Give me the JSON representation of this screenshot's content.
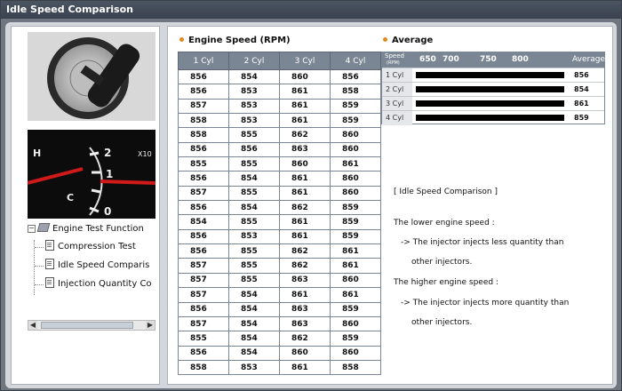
{
  "window": {
    "title": "Idle Speed Comparison"
  },
  "tree": {
    "root": "Engine Test Function",
    "items": [
      "Compression Test",
      "Idle Speed Comparis",
      "Injection Quantity Co"
    ]
  },
  "gauge": {
    "labels": [
      "H",
      "2",
      "X10",
      "1",
      "C",
      "0"
    ]
  },
  "engine_speed": {
    "title": "Engine Speed (RPM)",
    "headers": [
      "1 Cyl",
      "2 Cyl",
      "3 Cyl",
      "4 Cyl"
    ],
    "rows": [
      [
        "856",
        "854",
        "860",
        "856"
      ],
      [
        "856",
        "853",
        "861",
        "858"
      ],
      [
        "857",
        "853",
        "861",
        "859"
      ],
      [
        "858",
        "853",
        "861",
        "859"
      ],
      [
        "858",
        "855",
        "862",
        "860"
      ],
      [
        "856",
        "856",
        "863",
        "860"
      ],
      [
        "855",
        "855",
        "860",
        "861"
      ],
      [
        "856",
        "854",
        "861",
        "860"
      ],
      [
        "857",
        "855",
        "861",
        "860"
      ],
      [
        "856",
        "854",
        "862",
        "859"
      ],
      [
        "854",
        "855",
        "861",
        "859"
      ],
      [
        "856",
        "853",
        "861",
        "859"
      ],
      [
        "856",
        "855",
        "862",
        "861"
      ],
      [
        "857",
        "855",
        "862",
        "861"
      ],
      [
        "857",
        "855",
        "863",
        "860"
      ],
      [
        "857",
        "854",
        "861",
        "861"
      ],
      [
        "856",
        "854",
        "863",
        "859"
      ],
      [
        "857",
        "854",
        "863",
        "860"
      ],
      [
        "855",
        "854",
        "862",
        "859"
      ],
      [
        "856",
        "854",
        "860",
        "860"
      ],
      [
        "858",
        "853",
        "861",
        "858"
      ]
    ]
  },
  "average": {
    "title": "Average",
    "head": {
      "speed": "Speed",
      "unit": "(RPM)",
      "ticks": [
        "650",
        "700",
        "750",
        "800"
      ],
      "avg": "Average"
    },
    "rows": [
      {
        "label": "1 Cyl",
        "value": "856",
        "fill": 0.97
      },
      {
        "label": "2 Cyl",
        "value": "854",
        "fill": 0.97
      },
      {
        "label": "3 Cyl",
        "value": "861",
        "fill": 0.97
      },
      {
        "label": "4 Cyl",
        "value": "859",
        "fill": 0.97
      }
    ]
  },
  "info": {
    "heading": "[ Idle Speed Comparison ]",
    "lower_title": "The lower engine speed :",
    "lower_line1": "-> The injector injects less quantity than",
    "lower_line2": "other injectors.",
    "higher_title": "The higher engine speed :",
    "higher_line1": "-> The injector injects more quantity than",
    "higher_line2": "other injectors."
  },
  "colors": {
    "accent": "#e08a1e",
    "header": "#7b8694",
    "titlebar": "#414b57"
  }
}
